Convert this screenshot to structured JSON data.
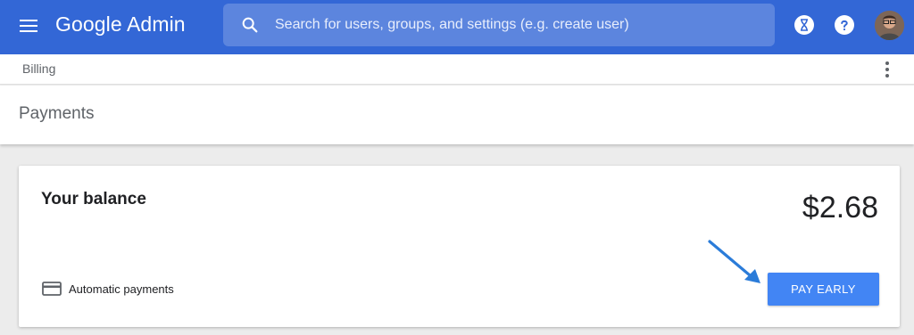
{
  "header": {
    "app_name": "Google Admin",
    "search_placeholder": "Search for users, groups, and settings (e.g. create user)",
    "icons": [
      "menu-icon",
      "search-icon",
      "hourglass-icon",
      "help-icon",
      "avatar"
    ]
  },
  "breadcrumb": {
    "label": "Billing"
  },
  "page": {
    "title": "Payments"
  },
  "balance_card": {
    "label": "Your balance",
    "amount": "$2.68",
    "auto_payments_label": "Automatic payments",
    "pay_button_label": "PAY EARLY"
  },
  "colors": {
    "header_bg": "#3367d6",
    "search_bg": "#5c85de",
    "button_bg": "#4285f4",
    "arrow": "#2b7cd9"
  }
}
